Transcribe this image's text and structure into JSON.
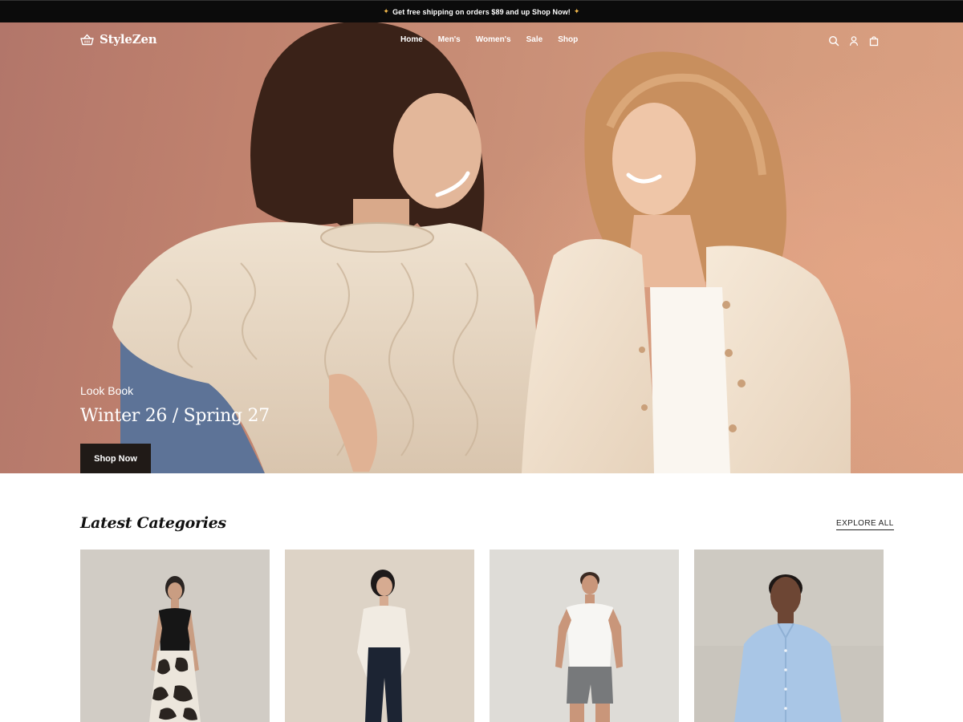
{
  "announcement": {
    "text": "Get free shipping on orders $89 and up Shop Now!",
    "icon": "sparkle-icon"
  },
  "header": {
    "brand": "StyleZen",
    "brand_icon": "basket-icon",
    "nav": [
      "Home",
      "Men's",
      "Women's",
      "Sale",
      "Shop"
    ],
    "icons": [
      "search-icon",
      "user-icon",
      "bag-icon"
    ]
  },
  "hero": {
    "kicker": "Look Book",
    "title": "Winter 26 / Spring 27",
    "cta": "Shop Now"
  },
  "categories": {
    "title": "Latest Categories",
    "explore_label": "EXPLORE ALL"
  },
  "colors": {
    "announcement_bg": "#0b0b0b",
    "button_dark": "#201a17",
    "hero_backdrop": "#c98f77"
  }
}
